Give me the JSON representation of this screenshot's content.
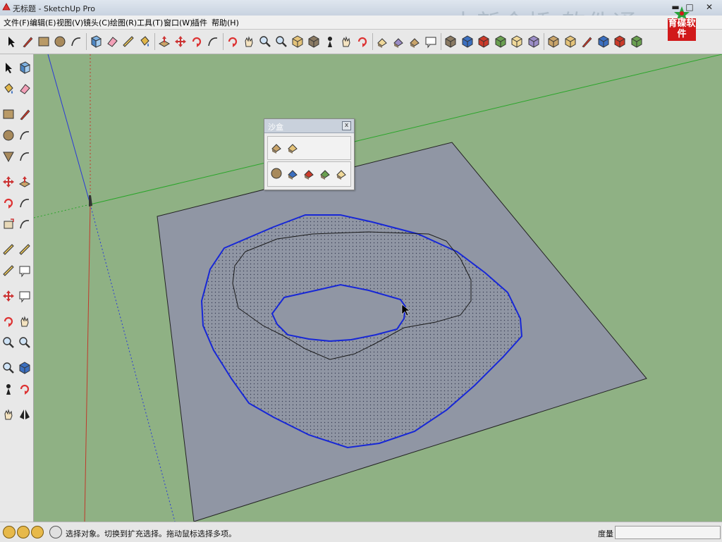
{
  "window": {
    "title": "无标题 - SketchUp Pro",
    "minimize": "▬",
    "maximize": "□",
    "close": "✕"
  },
  "menu": [
    {
      "label": "文件(F)"
    },
    {
      "label": "编辑(E)"
    },
    {
      "label": "视图(V)"
    },
    {
      "label": "镜头(C)"
    },
    {
      "label": "绘图(R)"
    },
    {
      "label": "工具(T)"
    },
    {
      "label": "窗口(W)"
    },
    {
      "label": "插件"
    },
    {
      "label": "帮助(H)"
    }
  ],
  "watermark": "中新金桥 软件通",
  "brand": {
    "text": "育碟软件",
    "color": "#d1191a"
  },
  "sandbox_panel": {
    "title": "沙盒",
    "close": "x"
  },
  "status": {
    "message": "选择对象。切换到扩充选择。拖动鼠标选择多项。",
    "measure_label": "度量",
    "measure_value": ""
  },
  "colors": {
    "ground": "#8fb184",
    "plane": "#9096a4",
    "selection": "#1727d6",
    "x_axis": "#2aa52a",
    "y_axis": "#2a3ad6",
    "z_axis": "#c0392b"
  },
  "icons": {
    "top_toolbar": [
      "select-icon",
      "pencil-icon",
      "rectangle-icon",
      "circle-icon",
      "arc-icon",
      "make-component-icon",
      "eraser-icon",
      "tape-measure-icon",
      "paint-bucket-icon",
      "push-pull-icon",
      "move-icon",
      "rotate-icon",
      "follow-me-icon",
      "orbit-icon",
      "pan-icon",
      "zoom-icon",
      "zoom-extents-icon",
      "previous-view-icon",
      "next-view-icon",
      "position-camera-icon",
      "walk-icon",
      "look-around-icon",
      "add-location-icon",
      "get-models-icon",
      "share-model-icon",
      "photo-textures-icon",
      "iso-view-icon",
      "top-view-icon",
      "front-view-icon",
      "right-view-icon",
      "back-view-icon",
      "left-view-icon",
      "xray-icon",
      "wireframe-icon",
      "hidden-line-icon",
      "shaded-icon",
      "shaded-textures-icon",
      "monochrome-icon"
    ],
    "left_toolbar": [
      "select-icon",
      "make-component-icon",
      "paint-bucket-icon",
      "eraser-icon",
      "rectangle-icon",
      "line-icon",
      "circle-icon",
      "arc-icon",
      "polygon-icon",
      "freehand-icon",
      "move-icon",
      "push-pull-icon",
      "rotate-icon",
      "follow-me-icon",
      "scale-icon",
      "offset-icon",
      "tape-measure-icon",
      "dimension-icon",
      "protractor-icon",
      "text-icon",
      "axes-icon",
      "3d-text-icon",
      "orbit-icon",
      "pan-icon",
      "zoom-icon",
      "zoom-window-icon",
      "zoom-extents-icon",
      "previous-view-icon",
      "position-camera-icon",
      "look-around-icon",
      "walk-icon",
      "section-plane-icon"
    ],
    "sandbox": [
      "from-contours-icon",
      "from-scratch-icon",
      "smoove-icon",
      "stamp-icon",
      "drape-icon",
      "add-detail-icon",
      "flip-edge-icon"
    ],
    "status": [
      "georeference-icon",
      "credits-icon",
      "user-icon",
      "help-icon"
    ]
  }
}
